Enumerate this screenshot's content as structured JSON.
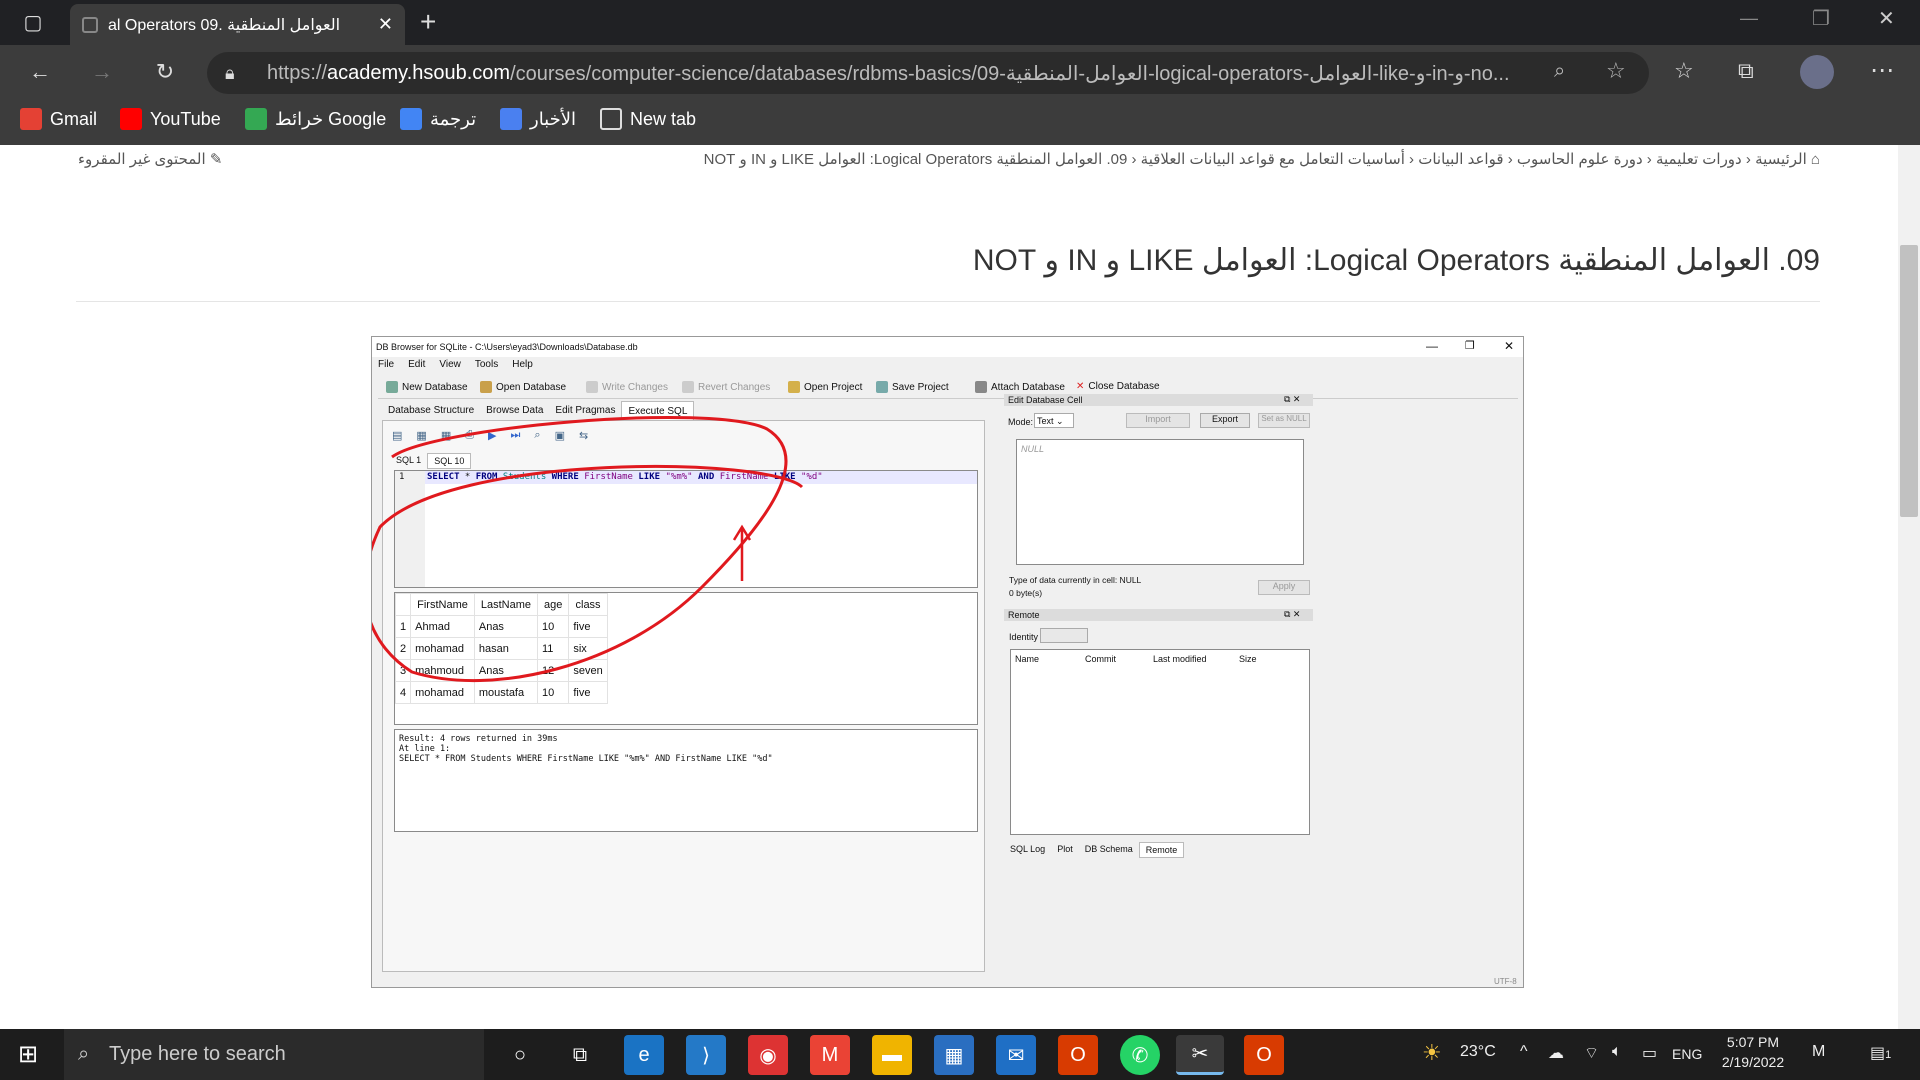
{
  "browser": {
    "tab_title": "al Operators العوامل المنطقية .09",
    "url_prefix": "https://",
    "url_host": "academy.hsoub.com",
    "url_path": "/courses/computer-science/databases/rdbms-basics/09-العوامل-المنطقية-logical-operators-العوامل-like-و-in-و-no...",
    "bookmarks": [
      "Gmail",
      "YouTube",
      "خرائط Google",
      "ترجمة",
      "الأخبار",
      "New tab"
    ]
  },
  "page": {
    "breadcrumb": [
      "الرئيسية",
      "دورات تعليمية",
      "دورة علوم الحاسوب",
      "قواعد البيانات",
      "أساسيات التعامل مع قواعد البيانات العلاقية",
      "09. العوامل المنطقية Logical Operators: العوامل LIKE و IN و NOT"
    ],
    "unread_label": "المحتوى غير المقروء",
    "title": "09. العوامل المنطقية Logical Operators: العوامل LIKE و IN و NOT"
  },
  "dbbrowser": {
    "window_title": "DB Browser for SQLite - C:\\Users\\eyad3\\Downloads\\Database.db",
    "menu": [
      "File",
      "Edit",
      "View",
      "Tools",
      "Help"
    ],
    "toolbar": [
      "New Database",
      "Open Database",
      "Write Changes",
      "Revert Changes",
      "Open Project",
      "Save Project",
      "Attach Database",
      "Close Database"
    ],
    "tabs": [
      "Database Structure",
      "Browse Data",
      "Edit Pragmas",
      "Execute SQL"
    ],
    "sql_tabs": [
      "SQL 1",
      "SQL 10"
    ],
    "line_number": "1",
    "query": "SELECT * FROM Students WHERE FirstName LIKE \"%m%\" AND FirstName LIKE \"%d\"",
    "columns": [
      "FirstName",
      "LastName",
      "age",
      "class"
    ],
    "rows": [
      [
        "1",
        "Ahmad",
        "Anas",
        "10",
        "five"
      ],
      [
        "2",
        "mohamad",
        "hasan",
        "11",
        "six"
      ],
      [
        "3",
        "mahmoud",
        "Anas",
        "12",
        "seven"
      ],
      [
        "4",
        "mohamad",
        "moustafa",
        "10",
        "five"
      ]
    ],
    "result_lines": [
      "Result: 4 rows returned in 39ms",
      "At line 1:",
      "SELECT * FROM Students WHERE FirstName LIKE \"%m%\" AND FirstName LIKE \"%d\""
    ],
    "edit_cell": {
      "title": "Edit Database Cell",
      "mode_label": "Mode:",
      "mode_value": "Text",
      "import": "Import",
      "export": "Export",
      "set_null": "Set as NULL",
      "null_text": "NULL",
      "type_text": "Type of data currently in cell: NULL",
      "size_text": "0 byte(s)",
      "apply": "Apply"
    },
    "remote": {
      "title": "Remote",
      "identity_label": "Identity",
      "columns": [
        "Name",
        "Commit",
        "Last modified",
        "Size"
      ]
    },
    "bottom_tabs": [
      "SQL Log",
      "Plot",
      "DB Schema",
      "Remote"
    ],
    "encoding": "UTF-8"
  },
  "taskbar": {
    "search_placeholder": "Type here to search",
    "weather": "23°C",
    "language": "ENG",
    "time": "5:07 PM",
    "date": "2/19/2022",
    "notification_count": "1"
  },
  "colors": {
    "annotation": "#e0191e",
    "sql_keyword": "#00007f",
    "sql_table": "#008080",
    "sql_column": "#7f007f"
  }
}
